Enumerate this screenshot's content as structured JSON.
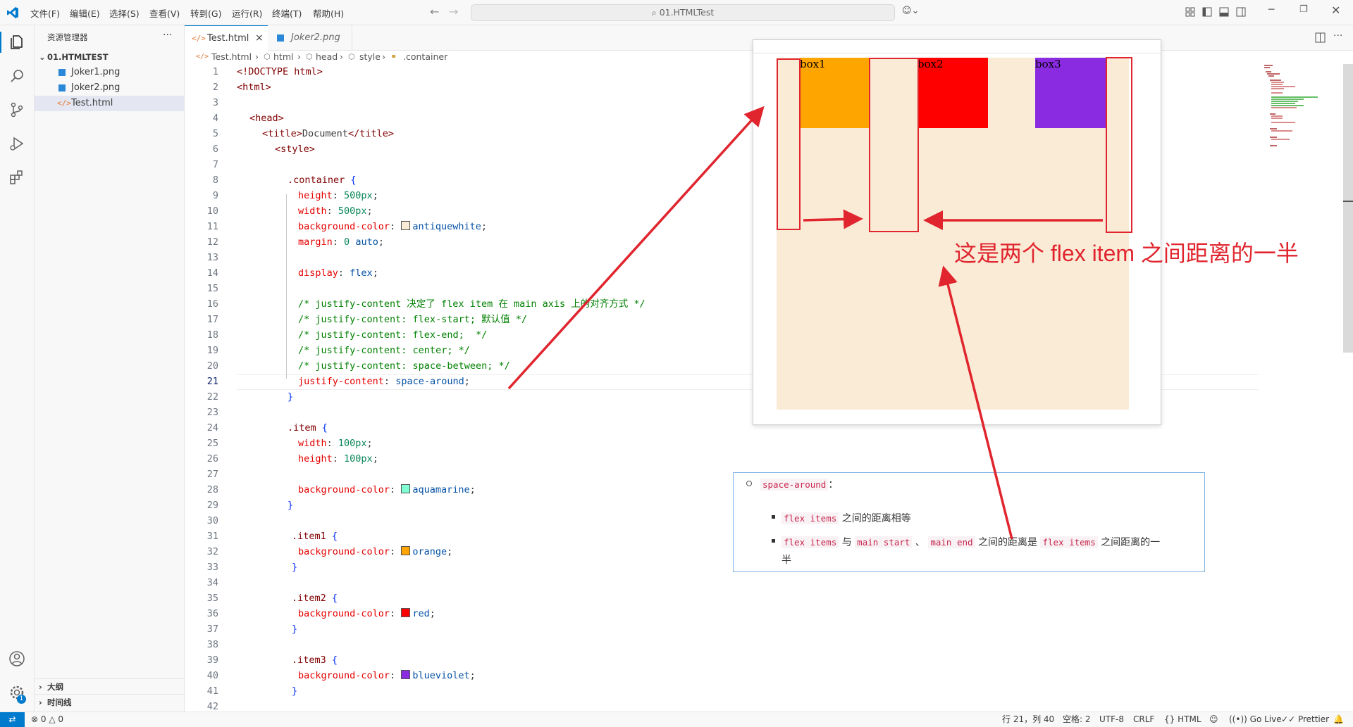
{
  "menu": {
    "items": [
      "文件(F)",
      "编辑(E)",
      "选择(S)",
      "查看(V)",
      "转到(G)",
      "运行(R)",
      "终端(T)",
      "帮助(H)"
    ],
    "search_text": "01.HTMLTest"
  },
  "sidebar": {
    "title": "资源管理器",
    "more": "···",
    "folder": "01.HTMLTEST",
    "files": [
      "Joker1.png",
      "Joker2.png",
      "Test.html"
    ],
    "bottom_sections": [
      "大纲",
      "时间线"
    ]
  },
  "tabs": [
    {
      "label": "Test.html",
      "close": "×"
    },
    {
      "label": "Joker2.png"
    }
  ],
  "breadcrumb": [
    "Test.html",
    "html",
    "head",
    "style",
    ".container"
  ],
  "code_lines": [
    {
      "n": "1"
    },
    {
      "n": "2"
    },
    {
      "n": "3"
    },
    {
      "n": "4"
    },
    {
      "n": "5"
    },
    {
      "n": "6"
    },
    {
      "n": "7"
    },
    {
      "n": "8"
    },
    {
      "n": "9"
    },
    {
      "n": "10"
    },
    {
      "n": "11"
    },
    {
      "n": "12"
    },
    {
      "n": "13"
    },
    {
      "n": "14"
    },
    {
      "n": "15"
    },
    {
      "n": "16"
    },
    {
      "n": "17"
    },
    {
      "n": "18"
    },
    {
      "n": "19"
    },
    {
      "n": "20"
    },
    {
      "n": "21"
    },
    {
      "n": "22"
    },
    {
      "n": "23"
    },
    {
      "n": "24"
    },
    {
      "n": "25"
    },
    {
      "n": "26"
    },
    {
      "n": "27"
    },
    {
      "n": "28"
    },
    {
      "n": "29"
    },
    {
      "n": "30"
    },
    {
      "n": "31"
    },
    {
      "n": "32"
    },
    {
      "n": "33"
    },
    {
      "n": "34"
    },
    {
      "n": "35"
    },
    {
      "n": "36"
    },
    {
      "n": "37"
    },
    {
      "n": "38"
    },
    {
      "n": "39"
    },
    {
      "n": "40"
    },
    {
      "n": "41"
    },
    {
      "n": "42"
    }
  ],
  "code": {
    "l1": "<!DOCTYPE html>",
    "l2": "<html>",
    "l4": "<head>",
    "l5a": "<title>",
    "l5b": "Document",
    "l5c": "</title>",
    "l6": "<style>",
    "l8": ".container",
    "l9p": "height",
    "l9v": "500px",
    "l10p": "width",
    "l10v": "500px",
    "l11p": "background-color",
    "l11v": "antiquewhite",
    "l12p": "margin",
    "l12v1": "0",
    "l12v2": "auto",
    "l14p": "display",
    "l14v": "flex",
    "l16": "/* justify-content 决定了 flex item 在 main axis 上的对齐方式 */",
    "l17": "/* justify-content: flex-start; 默认值 */",
    "l18": "/* justify-content: flex-end;  */",
    "l19": "/* justify-content: center; */",
    "l20": "/* justify-content: space-between; */",
    "l21p": "justify-content",
    "l21v": "space-around",
    "l24": ".item",
    "l25p": "width",
    "l25v": "100px",
    "l26p": "height",
    "l26v": "100px",
    "l28p": "background-color",
    "l28v": "aquamarine",
    "l31": ".item1",
    "l32p": "background-color",
    "l32v": "orange",
    "l35": ".item2",
    "l36p": "background-color",
    "l36v": "red",
    "l39": ".item3",
    "l40p": "background-color",
    "l40v": "blueviolet"
  },
  "preview": {
    "boxes": [
      {
        "label": "box1",
        "color": "#ffa500"
      },
      {
        "label": "box2",
        "color": "#ff0000"
      },
      {
        "label": "box3",
        "color": "#8a2be2"
      }
    ],
    "container_color": "#faebd7",
    "annotation": "这是两个 flex item 之间距离的一半"
  },
  "doc": {
    "bullet_code": "space-around",
    "colon": "：",
    "b1_code": "flex items",
    "b1_text": "之间的距离相等",
    "b2_code1": "flex items",
    "b2_t1": "与",
    "b2_code2": "main start",
    "b2_t2": "、",
    "b2_code3": "main end",
    "b2_t3": "之间的距离是",
    "b2_code4": "flex items",
    "b2_t4": "之间距离的一",
    "b2_t5": "半"
  },
  "status": {
    "errors": "0",
    "warnings": "0",
    "position": "行 21，列 40",
    "spaces": "空格: 2",
    "encoding": "UTF-8",
    "eol": "CRLF",
    "language": "HTML",
    "golive": "Go Live",
    "prettier": "Prettier"
  },
  "colors": {
    "accent": "#007acc",
    "annotation_red": "#e0252e"
  }
}
